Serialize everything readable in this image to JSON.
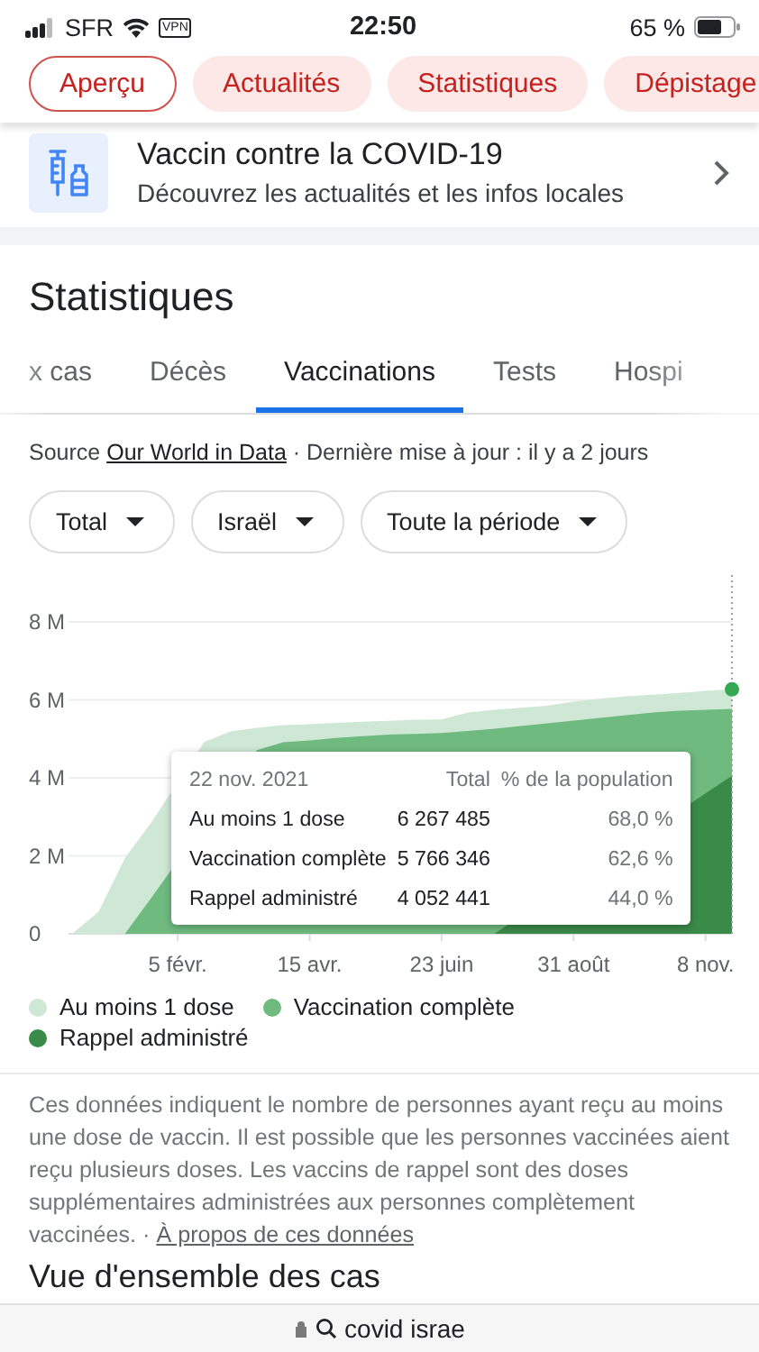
{
  "status_bar": {
    "carrier": "SFR",
    "vpn": "VPN",
    "time": "22:50",
    "battery": "65 %"
  },
  "nav_chips": [
    {
      "label": "Aperçu",
      "selected": true
    },
    {
      "label": "Actualités",
      "selected": false
    },
    {
      "label": "Statistiques",
      "selected": false
    },
    {
      "label": "Dépistage",
      "selected": false
    }
  ],
  "vaccine_card": {
    "title": "Vaccin contre la COVID-19",
    "subtitle": "Découvrez les actualités et les infos locales"
  },
  "statistics": {
    "heading": "Statistiques",
    "tabs": [
      {
        "label": "x cas",
        "selected": false
      },
      {
        "label": "Décès",
        "selected": false
      },
      {
        "label": "Vaccinations",
        "selected": true
      },
      {
        "label": "Tests",
        "selected": false
      },
      {
        "label": "Hospi",
        "selected": false
      }
    ],
    "source": {
      "prefix": "Source",
      "link": "Our World in Data",
      "suffix": "· Dernière mise à jour : il y a 2 jours"
    },
    "filters": [
      "Total",
      "Israël",
      "Toute la période"
    ],
    "chart_data": {
      "type": "area",
      "stacked": false,
      "categories": [
        null,
        null,
        null,
        null,
        "5 févr.",
        null,
        null,
        null,
        null,
        "15 avr.",
        null,
        null,
        null,
        null,
        "23 juin",
        null,
        null,
        null,
        null,
        "31 août",
        null,
        null,
        null,
        null,
        "8 nov.",
        null
      ],
      "ylim": [
        0,
        8
      ],
      "grid": true,
      "yticks": [
        {
          "value": 0,
          "label": "0"
        },
        {
          "value": 2,
          "label": "2 M"
        },
        {
          "value": 4,
          "label": "4 M"
        },
        {
          "value": 6,
          "label": "6 M"
        },
        {
          "value": 8,
          "label": "8 M"
        }
      ],
      "series": [
        {
          "name": "Au moins 1 dose",
          "color": "#cfe8d5",
          "values": [
            0,
            0.56,
            1.94,
            2.86,
            null,
            4.92,
            5.19,
            5.28,
            5.35,
            5.38,
            5.41,
            5.44,
            5.46,
            5.49,
            5.5,
            5.68,
            5.75,
            5.8,
            5.85,
            5.96,
            6.03,
            6.09,
            6.13,
            6.18,
            6.23,
            6.27
          ]
        },
        {
          "name": "Vaccination complète",
          "color": "#6fba7f",
          "values": [
            0,
            0,
            0,
            0.92,
            null,
            null,
            null,
            4.71,
            4.91,
            4.96,
            5.02,
            5.07,
            5.11,
            5.13,
            5.15,
            5.2,
            5.26,
            5.33,
            5.4,
            5.47,
            5.54,
            5.61,
            5.68,
            5.72,
            5.75,
            5.77
          ]
        },
        {
          "name": "Rappel administré",
          "color": "#3a8a48",
          "values": [
            0,
            0,
            0,
            0,
            0,
            0,
            0,
            0,
            0,
            0,
            0,
            0,
            0,
            0,
            0,
            0,
            0,
            null,
            null,
            null,
            null,
            null,
            null,
            null,
            null,
            4.05
          ]
        }
      ]
    },
    "tooltip": {
      "date": "22 nov. 2021",
      "columns": [
        "Total",
        "% de la population"
      ],
      "rows": [
        {
          "name": "Au moins 1 dose",
          "total": "6 267 485",
          "percent": "68,0 %"
        },
        {
          "name": "Vaccination complète",
          "total": "5 766 346",
          "percent": "62,6 %"
        },
        {
          "name": "Rappel administré",
          "total": "4 052 441",
          "percent": "44,0 %"
        }
      ]
    },
    "note": "Ces données indiquent le nombre de personnes ayant reçu au moins une dose de vaccin. Il est possible que les personnes vaccinées aient reçu plusieurs doses. Les vaccins de rappel sont des doses supplémentaires administrées aux personnes complètement vaccinées.",
    "note_separator": "·",
    "note_link": "À propos de ces données"
  },
  "next_heading": "Vue d'ensemble des cas",
  "url_bar": {
    "text": "covid israe"
  }
}
